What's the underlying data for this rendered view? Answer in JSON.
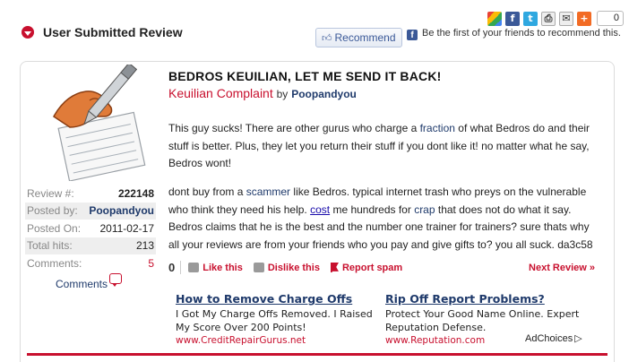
{
  "share": {
    "count": "0",
    "icons": [
      "google-icon",
      "facebook-icon",
      "twitter-icon",
      "print-icon",
      "email-icon",
      "plus-icon"
    ]
  },
  "header": {
    "title": "User Submitted Review"
  },
  "facebook": {
    "recommend_label": "Recommend",
    "notice": "Be the first of your friends to recommend this."
  },
  "review": {
    "title": "BEDROS KEUILIAN, LET ME SEND IT BACK!",
    "category": "Keuilian Complaint",
    "by": "by",
    "author": "Poopandyou",
    "p1": {
      "a": "This guy sucks! There are other gurus who charge a ",
      "k1": "fraction",
      "b": " of what Bedros do and their stuff is better. Plus, they let you return their stuff if you dont like it! no matter what he say, Bedros wont!"
    },
    "p2": {
      "a": "dont buy from a ",
      "k1": "scammer",
      "b": " like Bedros. typical internet trash who preys on the vulnerable who think they need his help. ",
      "k2": "cost",
      "c": " me hundreds for ",
      "k3": "crap",
      "d": " that does not do what it say. Bedros claims that he is the best and the number one trainer for trainers? sure thats why all your reviews are from your friends who you pay and give gifts to? you all suck. da3c58"
    }
  },
  "stats": [
    {
      "label": "Review #:",
      "value": "222148"
    },
    {
      "label": "Posted by:",
      "value": "Poopandyou"
    },
    {
      "label": "Posted On:",
      "value": "2011-02-17"
    },
    {
      "label": "Total hits:",
      "value": "213"
    },
    {
      "label": "Comments:",
      "value": "5"
    }
  ],
  "comments_link": "Comments",
  "actions": {
    "vote_count": "0",
    "like": "Like this",
    "dislike": "Dislike this",
    "report": "Report spam",
    "next": "Next Review »"
  },
  "ads": [
    {
      "headline": "How to Remove Charge Offs",
      "body": "I Got My Charge Offs Removed. I Raised My Score Over 200 Points!",
      "url": "www.CreditRepairGurus.net"
    },
    {
      "headline": "Rip Off Report Problems?",
      "body": "Protect Your Good Name Online. Expert Reputation Defense.",
      "url": "www.Reputation.com"
    }
  ],
  "adchoices": "AdChoices",
  "colors": {
    "accent_red": "#c8102e",
    "navy": "#1f3a6b",
    "facebook": "#3b5998"
  }
}
